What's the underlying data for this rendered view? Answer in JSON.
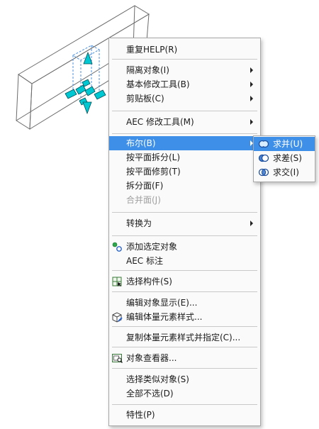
{
  "context_menu": {
    "items": [
      {
        "label": "重复HELP(R)"
      },
      {
        "label": "隔离对象(I)"
      },
      {
        "label": "基本修改工具(B)"
      },
      {
        "label": "剪贴板(C)"
      },
      {
        "label": "AEC 修改工具(M)"
      },
      {
        "label": "布尔(B)"
      },
      {
        "label": "按平面拆分(L)"
      },
      {
        "label": "按平面修剪(T)"
      },
      {
        "label": "拆分面(F)"
      },
      {
        "label": "合并面(J)"
      },
      {
        "label": "转换为"
      },
      {
        "label": "添加选定对象",
        "icon": "add-selected-icon"
      },
      {
        "label": "AEC 标注"
      },
      {
        "label": "选择构件(S)",
        "icon": "select-components-icon"
      },
      {
        "label": "编辑对象显示(E)..."
      },
      {
        "label": "编辑体量元素样式...",
        "icon": "edit-mass-style-icon"
      },
      {
        "label": "复制体量元素样式并指定(C)..."
      },
      {
        "label": "对象查看器...",
        "icon": "object-viewer-icon"
      },
      {
        "label": "选择类似对象(S)"
      },
      {
        "label": "全部不选(D)"
      },
      {
        "label": "特性(P)"
      }
    ],
    "highlighted_item": "布尔(B)",
    "disabled_item": "合并面(J)"
  },
  "boolean_submenu": {
    "items": [
      {
        "label": "求并(U)",
        "icon": "union-icon"
      },
      {
        "label": "求差(S)",
        "icon": "subtract-icon"
      },
      {
        "label": "求交(I)",
        "icon": "intersect-icon"
      }
    ]
  },
  "colors": {
    "highlight": "#3d8fe8",
    "grip": "#00c8d2",
    "menu_background": "#fafafa"
  }
}
